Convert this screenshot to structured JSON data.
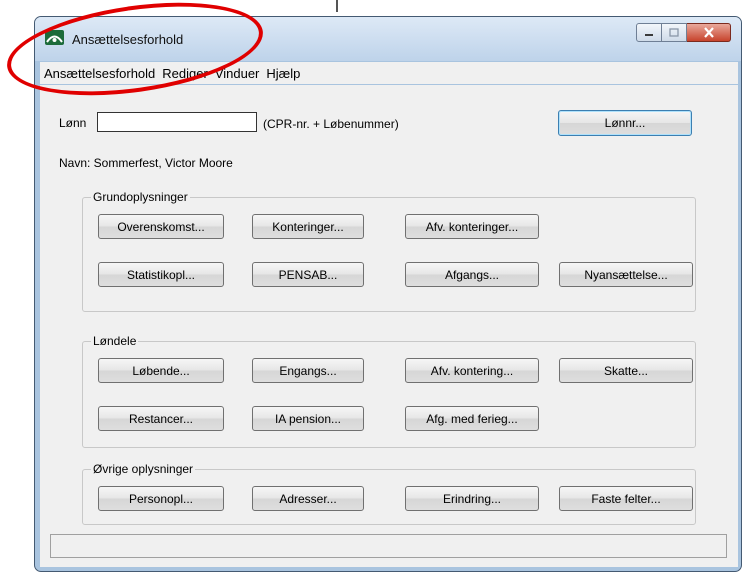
{
  "window": {
    "title": "Ansættelsesforhold"
  },
  "menu": [
    "Ansættelsesforhold",
    "Rediger",
    "Vinduer",
    "Hjælp"
  ],
  "lonnr": {
    "label": "Lønn",
    "value": "",
    "hint": "(CPR-nr. + Løbenummer)",
    "button": "Lønnr..."
  },
  "navn": {
    "text": "Navn: Sommerfest, Victor Moore"
  },
  "groups": {
    "grundoplysninger": {
      "title": "Grundoplysninger",
      "buttons": [
        "Overenskomst...",
        "Konteringer...",
        "Afv. konteringer...",
        "Statistikopl...",
        "PENSAB...",
        "Afgangs...",
        "Nyansættelse..."
      ]
    },
    "londele": {
      "title": "Løndele",
      "buttons": [
        "Løbende...",
        "Engangs...",
        "Afv. kontering...",
        "Skatte...",
        "Restancer...",
        "IA pension...",
        "Afg. med ferieg..."
      ]
    },
    "ovrige": {
      "title": "Øvrige oplysninger",
      "buttons": [
        "Personopl...",
        "Adresser...",
        "Erindring...",
        "Faste felter..."
      ]
    }
  },
  "annotation": {
    "color": "#e00000"
  }
}
